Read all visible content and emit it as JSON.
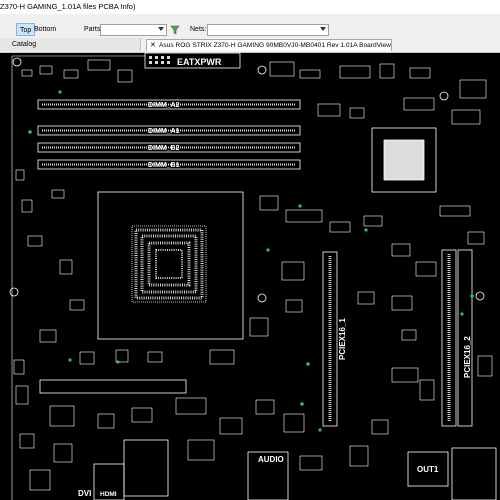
{
  "window": {
    "title": "Z370-H GAMING_1.01A files PCBA Info)"
  },
  "toolbar": {
    "top_label": "Top",
    "bottom_label": "Bottom",
    "parts_label": "Parts:",
    "parts_value": "",
    "nets_label": "Nets:",
    "nets_value": ""
  },
  "tabs": {
    "catalog_label": "Catalog",
    "close_glyph": "✕",
    "document_tab": "Asus ROG STRIX Z370-H GAMING 90MB0VJ0-MB0401 Rev 1.01A BoardView"
  },
  "board": {
    "atx_power_label": "EATXPWR",
    "dimm_labels": [
      "DIMM_A2",
      "DIMM_A1",
      "DIMM_B2",
      "DIMM_B1"
    ],
    "pcie_labels": [
      "PCIEX16_1",
      "PCIEX16_2"
    ],
    "bottom_labels": [
      "DVI",
      "HDMI",
      "AUDIO",
      "OUT1"
    ],
    "colors": {
      "silkscreen": "#ffffff",
      "background": "#000000",
      "pads": "#cfcfcf",
      "vias": "#2fb0a8"
    }
  }
}
